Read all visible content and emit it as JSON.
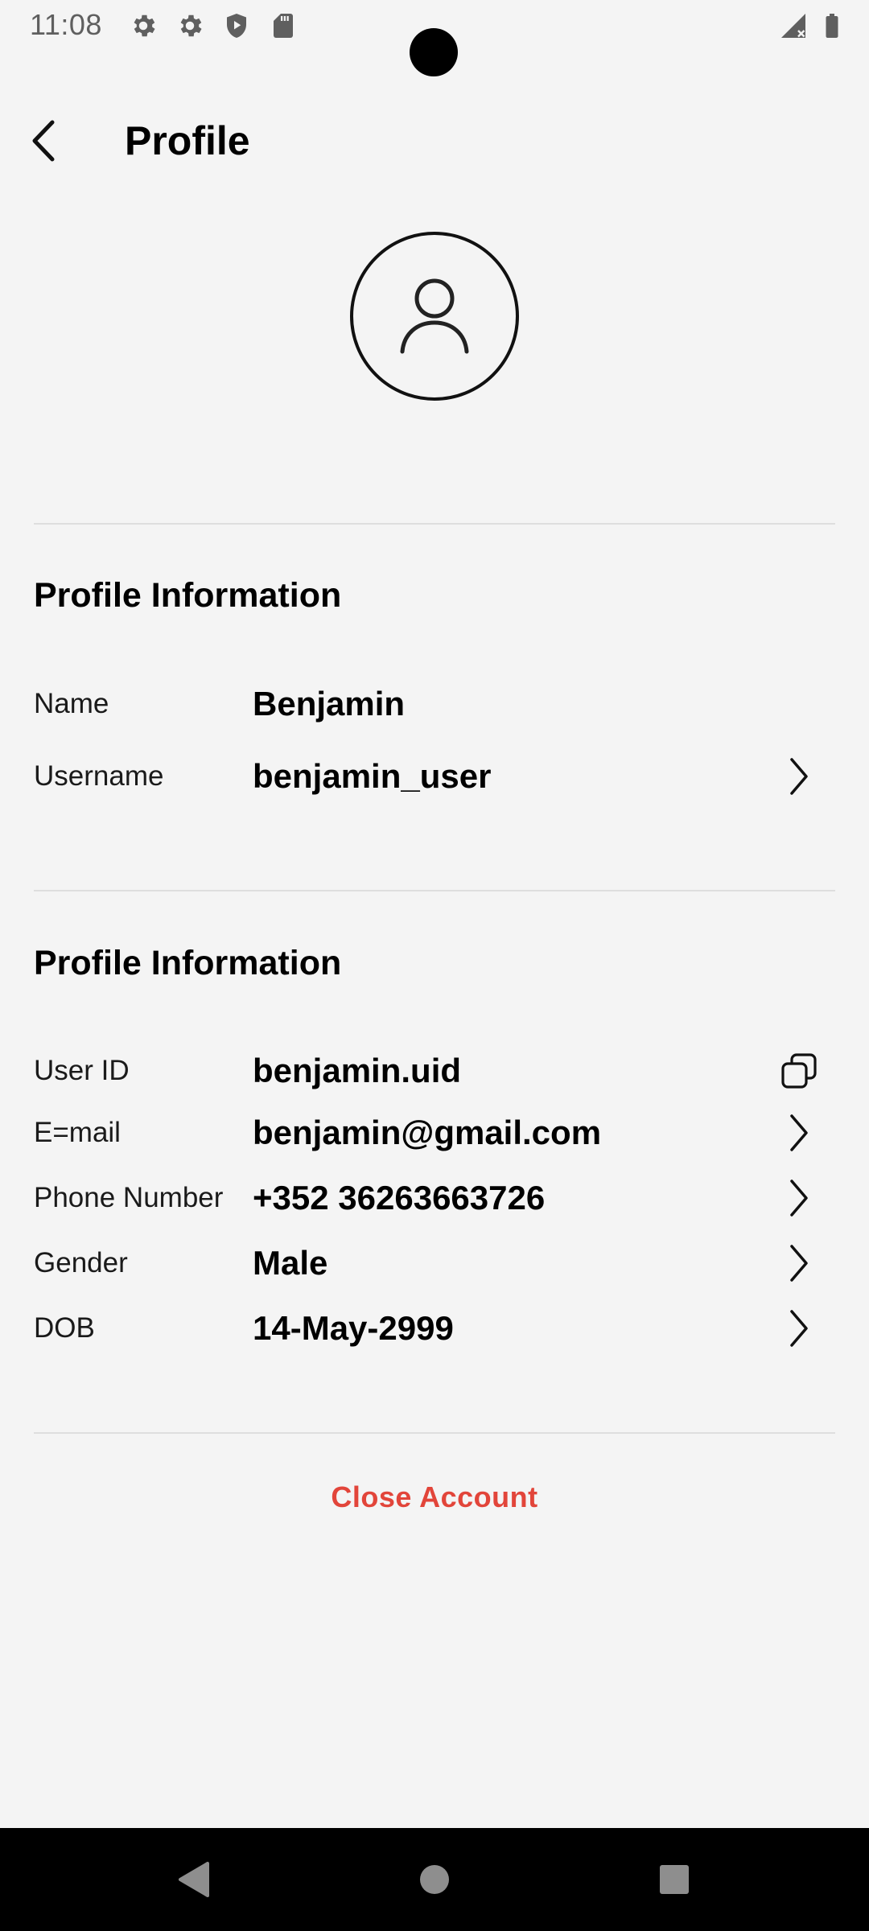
{
  "status_bar": {
    "time": "11:08",
    "icons": [
      "gear-icon",
      "gear-icon",
      "shield-play-icon",
      "sd-card-icon",
      "signal-icon",
      "battery-icon"
    ]
  },
  "header": {
    "title": "Profile",
    "back_icon": "chevron-left-icon"
  },
  "avatar": {
    "icon": "user-icon"
  },
  "section1": {
    "title": "Profile Information",
    "rows": [
      {
        "label": "Name",
        "value": "Benjamin"
      },
      {
        "label": "Username",
        "value": "benjamin_user",
        "action": "chevron-right-icon"
      }
    ]
  },
  "section2": {
    "title": "Profile Information",
    "rows": [
      {
        "label": "User ID",
        "value": "benjamin.uid",
        "action": "copy-icon"
      },
      {
        "label": "E=mail",
        "value": "benjamin@gmail.com",
        "action": "chevron-right-icon"
      },
      {
        "label": "Phone Number",
        "value": "+352 36263663726",
        "action": "chevron-right-icon"
      },
      {
        "label": "Gender",
        "value": "Male",
        "action": "chevron-right-icon"
      },
      {
        "label": "DOB",
        "value": "14-May-2999",
        "action": "chevron-right-icon"
      }
    ]
  },
  "footer": {
    "close_account_label": "Close Account"
  },
  "nav_bar": {
    "buttons": [
      "back-triangle-icon",
      "home-circle-icon",
      "recents-square-icon"
    ]
  },
  "colors": {
    "background": "#f4f4f4",
    "danger": "#e2453a",
    "divider": "#dedede",
    "text": "#000000"
  }
}
